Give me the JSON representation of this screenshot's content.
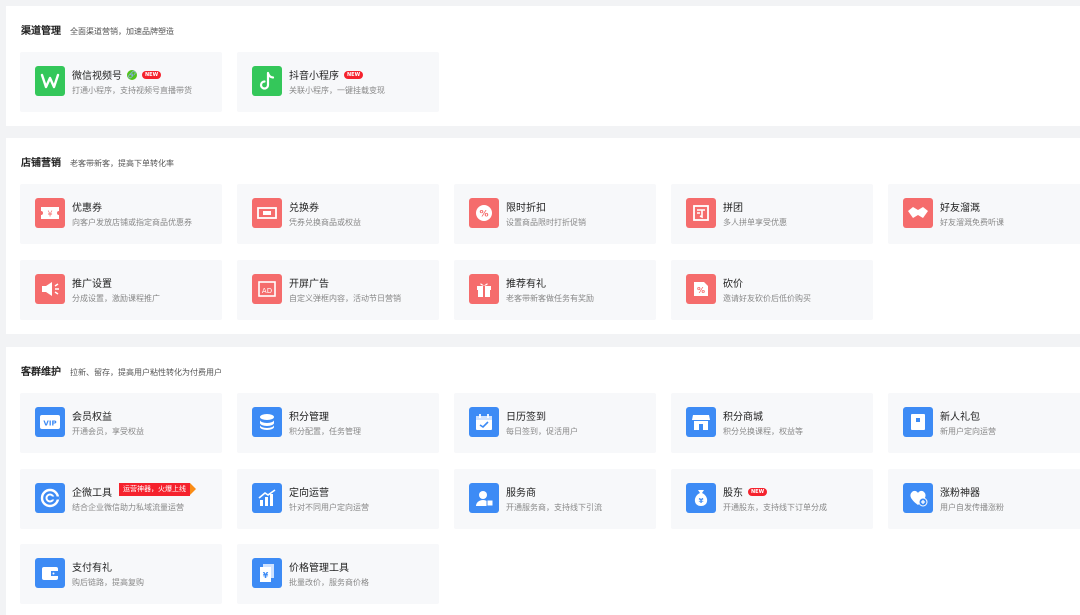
{
  "channel": {
    "title": "渠道管理",
    "desc": "全面渠道营销，加速品牌塑造",
    "items": [
      {
        "title": "微信视频号",
        "desc": "打通小程序，支持视频号直播带货",
        "badge": "NEW",
        "link_icon": "🔗"
      },
      {
        "title": "抖音小程序",
        "desc": "关联小程序，一键挂载变现",
        "badge": "NEW"
      }
    ]
  },
  "store": {
    "title": "店铺营销",
    "desc": "老客带新客，提高下单转化率",
    "items": [
      {
        "title": "优惠券",
        "desc": "向客户发放店铺或指定商品优惠券"
      },
      {
        "title": "兑换券",
        "desc": "凭券兑换商品或权益"
      },
      {
        "title": "限时折扣",
        "desc": "设置商品限时打折促销"
      },
      {
        "title": "拼团",
        "desc": "多人拼单享受优惠"
      },
      {
        "title": "好友溜溉",
        "desc": "好友溜溉免费听课"
      },
      {
        "title": "推广设置",
        "desc": "分成设置，激励课程推广"
      },
      {
        "title": "开屏广告",
        "desc": "自定义弹框内容，活动节日营销"
      },
      {
        "title": "推荐有礼",
        "desc": "老客带新客做任务有奖励"
      },
      {
        "title": "砍价",
        "desc": "邀请好友砍价后低价购买"
      }
    ]
  },
  "customer": {
    "title": "客群维护",
    "desc": "拉新、留存，提高用户粘性转化为付费用户",
    "items": [
      {
        "title": "会员权益",
        "desc": "开通会员，享受权益"
      },
      {
        "title": "积分管理",
        "desc": "积分配置，任务管理"
      },
      {
        "title": "日历签到",
        "desc": "每日签到，促活用户"
      },
      {
        "title": "积分商城",
        "desc": "积分兑换课程，权益等"
      },
      {
        "title": "新人礼包",
        "desc": "新用户定向运营"
      },
      {
        "title": "企微工具",
        "desc": "结合企业微信助力私域流量运营",
        "promo": "运营神器，火爆上线"
      },
      {
        "title": "定向运营",
        "desc": "针对不同用户定向运营"
      },
      {
        "title": "服务商",
        "desc": "开通服务商，支持线下引流"
      },
      {
        "title": "股东",
        "desc": "开通股东，支持线下订单分成",
        "badge": "NEW"
      },
      {
        "title": "涨粉神器",
        "desc": "用户自发传播涨粉"
      },
      {
        "title": "支付有礼",
        "desc": "购后链路，提高复购"
      },
      {
        "title": "价格管理工具",
        "desc": "批量改价，服务商价格"
      }
    ]
  },
  "colors": {
    "red": "#f56c6c",
    "blue": "#3d8bf5",
    "green": "#34c75a",
    "badge": "#f5222d"
  }
}
